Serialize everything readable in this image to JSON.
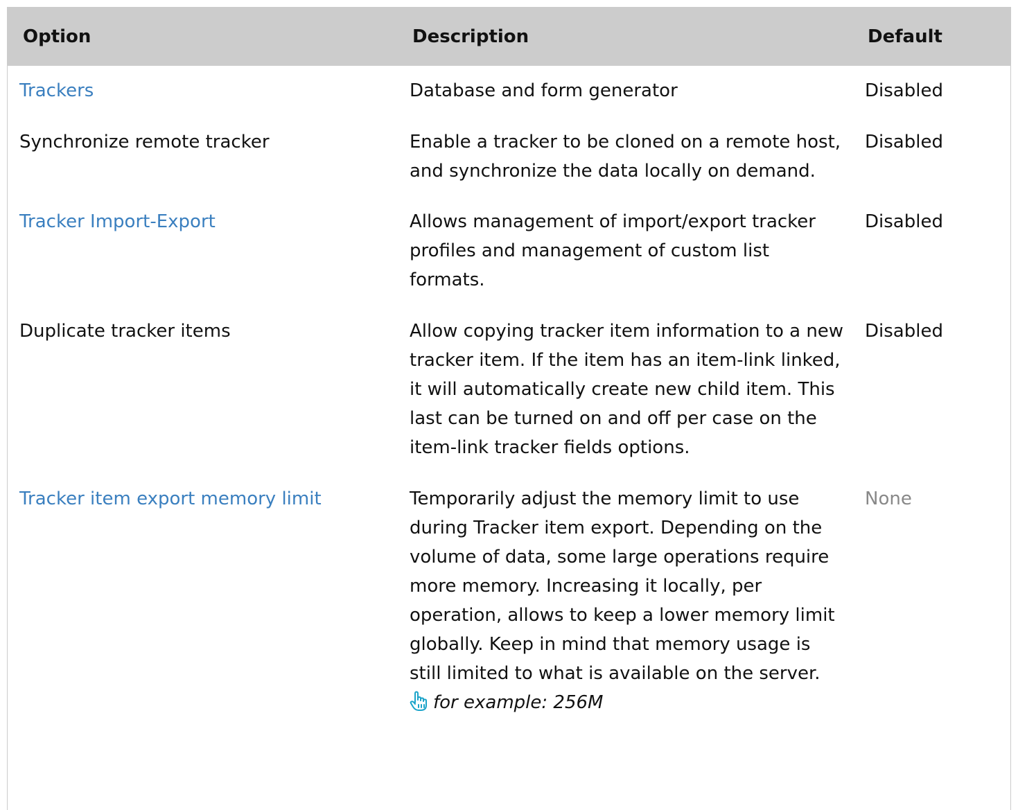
{
  "table": {
    "headers": {
      "option": "Option",
      "description": "Description",
      "default": "Default"
    },
    "rows": [
      {
        "option": "Trackers",
        "option_is_link": true,
        "description": "Database and form generator",
        "default": "Disabled"
      },
      {
        "option": "Synchronize remote tracker",
        "option_is_link": false,
        "description": "Enable a tracker to be cloned on a remote host, and synchronize the data locally on demand.",
        "default": "Disabled"
      },
      {
        "option": "Tracker Import-Export",
        "option_is_link": true,
        "description": "Allows management of import/export tracker profiles and management of custom list formats.",
        "default": "Disabled"
      },
      {
        "option": "Duplicate tracker items",
        "option_is_link": false,
        "description": "Allow copying tracker item information to a new tracker item. If the item has an item-link linked, it will automatically create new child item. This last can be turned on and off per case on the item-link tracker fields options.",
        "default": "Disabled"
      },
      {
        "option": "Tracker item export memory limit",
        "option_is_link": true,
        "description": "Temporarily adjust the memory limit to use during Tracker item export. Depending on the volume of data, some large operations require more memory. Increasing it locally, per operation, allows to keep a lower memory limit globally. Keep in mind that memory usage is still limited to what is available on the server.",
        "example": "for example: 256M",
        "example_icon": "pointing-hand-icon",
        "default": "None",
        "default_muted": true
      }
    ]
  },
  "colors": {
    "header_bg": "#cccccc",
    "link": "#3a7fbf",
    "muted": "#888888",
    "hand_icon": "#1aa3c9"
  }
}
